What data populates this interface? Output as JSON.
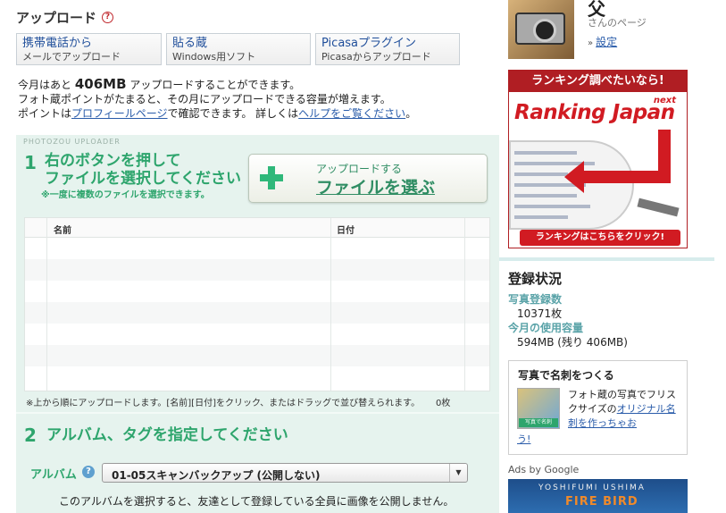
{
  "header": {
    "title": "アップロード",
    "help_glyph": "?"
  },
  "tabs": [
    {
      "label": "携帯電話から",
      "sub": "メールでアップロード"
    },
    {
      "label": "貼る蔵",
      "sub": "Windows用ソフト"
    },
    {
      "label": "Picasaプラグイン",
      "sub": "Picasaからアップロード"
    }
  ],
  "info": {
    "line1_pre": "今月はあと",
    "remaining": "406MB",
    "line1_post": "アップロードすることができます。",
    "line2": "フォト蔵ポイントがたまると、その月にアップロードできる容量が増えます。",
    "line3_pre": "ポイントは",
    "profile_link": "プロフィールページ",
    "line3_mid": "で確認できます。 詳しくは",
    "help_link": "ヘルプをご覧ください",
    "line3_post": "。"
  },
  "uploader": {
    "label": "PHOTOZOU UPLOADER",
    "step1": {
      "num": "1",
      "line1": "右のボタンを押して",
      "line2": "ファイルを選択してください",
      "note": "※一度に複数のファイルを選択できます。"
    },
    "button": {
      "sub": "アップロードする",
      "main": "ファイルを選ぶ"
    },
    "table": {
      "col_name": "名前",
      "col_date": "日付"
    },
    "note": "※上から順にアップロードします。[名前][日付]をクリック、またはドラッグで並び替えられます。",
    "count": "0枚",
    "step2": {
      "num": "2",
      "text": "アルバム、タグを指定してください"
    },
    "album": {
      "label": "アルバム",
      "help_glyph": "?",
      "selected": "01-05スキャンバックアップ (公開しない)",
      "arrow": "▼",
      "note": "このアルバムを選択すると、友達として登録している全員に画像を公開しません。"
    }
  },
  "sidebar": {
    "user_name": "父",
    "user_page": "さんのページ",
    "settings_arrow": "»",
    "settings": "設定",
    "banner": {
      "top": "ランキング調べたいなら!",
      "logo": "Ranking Japan",
      "next": "next",
      "bottom": "ランキングはこちらをクリック!"
    },
    "status": {
      "title": "登録状況",
      "photo_count_label": "写真登録数",
      "photo_count": "10371枚",
      "usage_label": "今月の使用容量",
      "usage": "594MB (残り 406MB)"
    },
    "meishi": {
      "title": "写真で名刺をつくる",
      "tag": "写真で名刺",
      "text_pre": "フォト蔵の写真でフリスクサイズの",
      "link1": "オリジナル名刺を作っちゃお",
      "link2": "う!"
    },
    "ads_label": "Ads by Google",
    "ad": {
      "line1": "YOSHIFUMI USHIMA",
      "line2": "FIRE BIRD"
    }
  },
  "colors": {
    "accent_green": "#2ea56d",
    "link_blue": "#2a5caa",
    "banner_red": "#d11b22",
    "status_teal": "#5aa3a8"
  }
}
